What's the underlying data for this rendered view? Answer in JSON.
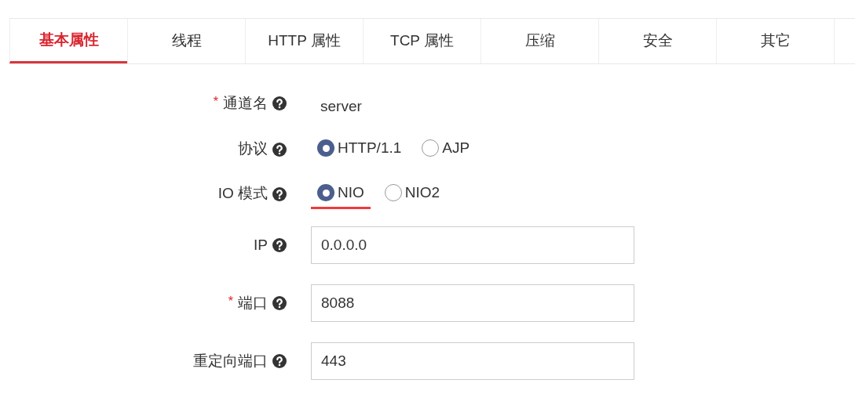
{
  "tabs": [
    {
      "label": "基本属性",
      "selected": true
    },
    {
      "label": "线程",
      "selected": false
    },
    {
      "label": "HTTP 属性",
      "selected": false
    },
    {
      "label": "TCP 属性",
      "selected": false
    },
    {
      "label": "压缩",
      "selected": false
    },
    {
      "label": "安全",
      "selected": false
    },
    {
      "label": "其它",
      "selected": false
    }
  ],
  "fields": [
    {
      "kind": "text",
      "label": "通道名",
      "required_mark": "*",
      "value": "server"
    },
    {
      "kind": "radio",
      "label": "协议",
      "options": [
        {
          "label": "HTTP/1.1",
          "selected": true,
          "underlined": false
        },
        {
          "label": "AJP",
          "selected": false,
          "underlined": false
        }
      ]
    },
    {
      "kind": "radio",
      "label": "IO 模式",
      "options": [
        {
          "label": "NIO",
          "selected": true,
          "underlined": true
        },
        {
          "label": "NIO2",
          "selected": false,
          "underlined": false
        }
      ]
    },
    {
      "kind": "input",
      "label": "IP",
      "value": "0.0.0.0"
    },
    {
      "kind": "input",
      "label": "端口",
      "required_mark": "*",
      "value": "8088"
    },
    {
      "kind": "input",
      "label": "重定向端口",
      "value": "443"
    }
  ]
}
